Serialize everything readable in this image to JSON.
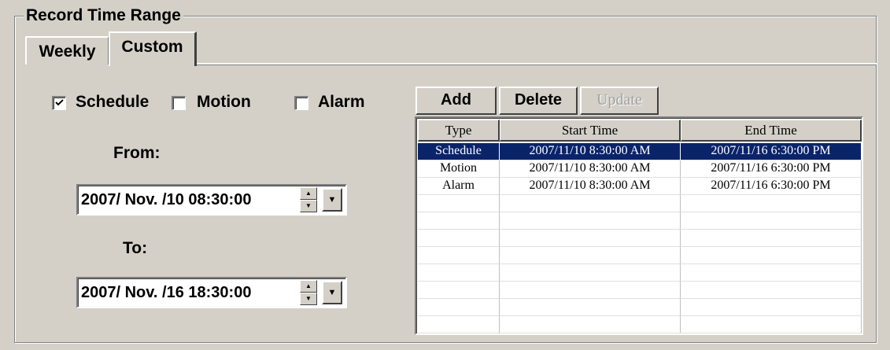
{
  "group": {
    "title": "Record Time Range"
  },
  "tabs": [
    {
      "label": "Weekly",
      "active": false
    },
    {
      "label": "Custom",
      "active": true
    }
  ],
  "checkboxes": [
    {
      "label": "Schedule",
      "checked": true
    },
    {
      "label": "Motion",
      "checked": false
    },
    {
      "label": "Alarm",
      "checked": false
    }
  ],
  "from": {
    "label": "From:",
    "value": "2007/ Nov. /10 08:30:00"
  },
  "to": {
    "label": "To:",
    "value": "2007/ Nov. /16 18:30:00"
  },
  "buttons": {
    "add": "Add",
    "delete": "Delete",
    "update": "Update",
    "update_enabled": false
  },
  "table": {
    "columns": [
      "Type",
      "Start Time",
      "End Time"
    ],
    "rows": [
      {
        "type": "Schedule",
        "start": "2007/11/10 8:30:00 AM",
        "end": "2007/11/16 6:30:00 PM",
        "selected": true
      },
      {
        "type": "Motion",
        "start": "2007/11/10 8:30:00 AM",
        "end": "2007/11/16 6:30:00 PM",
        "selected": false
      },
      {
        "type": "Alarm",
        "start": "2007/11/10 8:30:00 AM",
        "end": "2007/11/16 6:30:00 PM",
        "selected": false
      }
    ]
  },
  "icons": {
    "check": "checkmark-icon",
    "spin_up": "arrow-up-icon",
    "spin_down": "arrow-down-icon",
    "dropdown": "chevron-down-icon"
  },
  "colors": {
    "selection": "#0a246a",
    "face": "#d4d0c8"
  }
}
